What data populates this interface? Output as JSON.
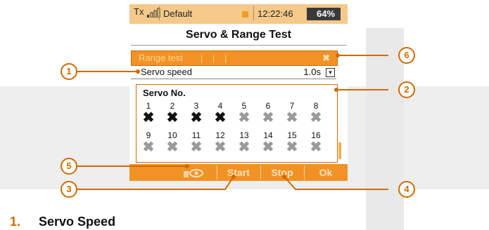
{
  "status": {
    "tx_label": "Tx",
    "model": "Default",
    "time": "12:22:46",
    "battery": "64%",
    "battery_level_percent": 64
  },
  "title": "Servo & Range Test",
  "range_test": {
    "label": "Range test",
    "state_icon": "x-icon"
  },
  "servo_speed": {
    "label": "Servo speed",
    "value": "1.0s",
    "dropdown_icon": "chevron-down-icon"
  },
  "servo_grid": {
    "title": "Servo No.",
    "servos": [
      {
        "num": "1",
        "active": true
      },
      {
        "num": "2",
        "active": true
      },
      {
        "num": "3",
        "active": true
      },
      {
        "num": "4",
        "active": true
      },
      {
        "num": "5",
        "active": false
      },
      {
        "num": "6",
        "active": false
      },
      {
        "num": "7",
        "active": false
      },
      {
        "num": "8",
        "active": false
      },
      {
        "num": "9",
        "active": false
      },
      {
        "num": "10",
        "active": false
      },
      {
        "num": "11",
        "active": false
      },
      {
        "num": "12",
        "active": false
      },
      {
        "num": "13",
        "active": false
      },
      {
        "num": "14",
        "active": false
      },
      {
        "num": "15",
        "active": false
      },
      {
        "num": "16",
        "active": false
      }
    ]
  },
  "bottom_bar": {
    "start": "Start",
    "stop": "Stop",
    "ok": "Ok",
    "icon": "eye-icon"
  },
  "callouts": [
    "1",
    "2",
    "3",
    "4",
    "5",
    "6"
  ],
  "caption": {
    "number": "1.",
    "text": "Servo Speed"
  },
  "colors": {
    "accent": "#f29224",
    "callout": "#d06b00"
  }
}
